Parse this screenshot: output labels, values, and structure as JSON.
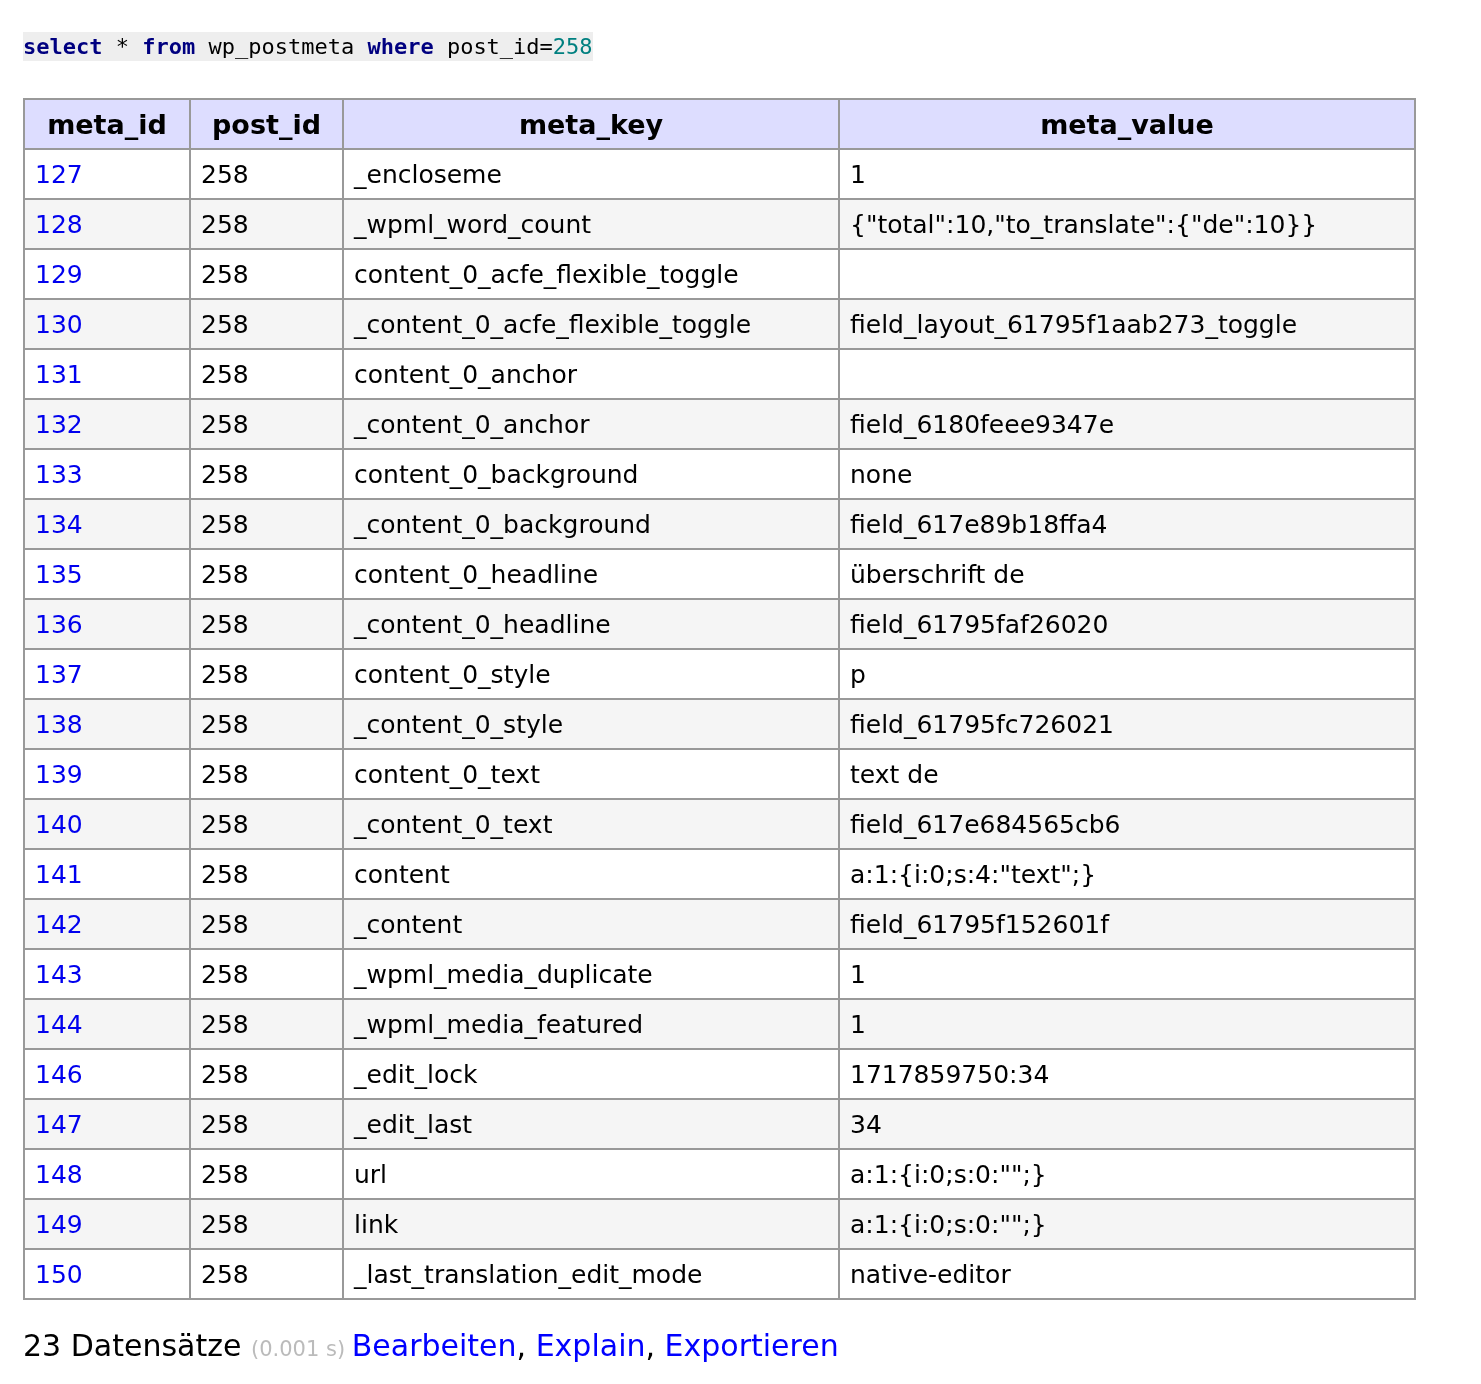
{
  "query": [
    {
      "text": "select",
      "kind": "keyword"
    },
    {
      "text": " * ",
      "kind": "plain"
    },
    {
      "text": "from",
      "kind": "keyword"
    },
    {
      "text": " wp_postmeta ",
      "kind": "plain"
    },
    {
      "text": "where",
      "kind": "keyword"
    },
    {
      "text": " post_id=",
      "kind": "plain"
    },
    {
      "text": "258",
      "kind": "number"
    }
  ],
  "table": {
    "columns": [
      "meta_id",
      "post_id",
      "meta_key",
      "meta_value"
    ],
    "rows": [
      [
        "127",
        "258",
        "_encloseme",
        "1"
      ],
      [
        "128",
        "258",
        "_wpml_word_count",
        "{\"total\":10,\"to_translate\":{\"de\":10}}"
      ],
      [
        "129",
        "258",
        "content_0_acfe_flexible_toggle",
        ""
      ],
      [
        "130",
        "258",
        "_content_0_acfe_flexible_toggle",
        "field_layout_61795f1aab273_toggle"
      ],
      [
        "131",
        "258",
        "content_0_anchor",
        ""
      ],
      [
        "132",
        "258",
        "_content_0_anchor",
        "field_6180feee9347e"
      ],
      [
        "133",
        "258",
        "content_0_background",
        "none"
      ],
      [
        "134",
        "258",
        "_content_0_background",
        "field_617e89b18ffa4"
      ],
      [
        "135",
        "258",
        "content_0_headline",
        "überschrift de"
      ],
      [
        "136",
        "258",
        "_content_0_headline",
        "field_61795faf26020"
      ],
      [
        "137",
        "258",
        "content_0_style",
        "p"
      ],
      [
        "138",
        "258",
        "_content_0_style",
        "field_61795fc726021"
      ],
      [
        "139",
        "258",
        "content_0_text",
        "text de"
      ],
      [
        "140",
        "258",
        "_content_0_text",
        "field_617e684565cb6"
      ],
      [
        "141",
        "258",
        "content",
        "a:1:{i:0;s:4:\"text\";}"
      ],
      [
        "142",
        "258",
        "_content",
        "field_61795f152601f"
      ],
      [
        "143",
        "258",
        "_wpml_media_duplicate",
        "1"
      ],
      [
        "144",
        "258",
        "_wpml_media_featured",
        "1"
      ],
      [
        "146",
        "258",
        "_edit_lock",
        "1717859750:34"
      ],
      [
        "147",
        "258",
        "_edit_last",
        "34"
      ],
      [
        "148",
        "258",
        "url",
        "a:1:{i:0;s:0:\"\";}"
      ],
      [
        "149",
        "258",
        "link",
        "a:1:{i:0;s:0:\"\";}"
      ],
      [
        "150",
        "258",
        "_last_translation_edit_mode",
        "native-editor"
      ]
    ]
  },
  "footer": [
    {
      "text": "23 Datensätze ",
      "kind": "text"
    },
    {
      "text": "(0.001 s) ",
      "kind": "muted"
    },
    {
      "text": "Bearbeiten",
      "kind": "link"
    },
    {
      "text": ", ",
      "kind": "text"
    },
    {
      "text": "Explain",
      "kind": "link"
    },
    {
      "text": ", ",
      "kind": "text"
    },
    {
      "text": "Exportieren",
      "kind": "link"
    }
  ]
}
